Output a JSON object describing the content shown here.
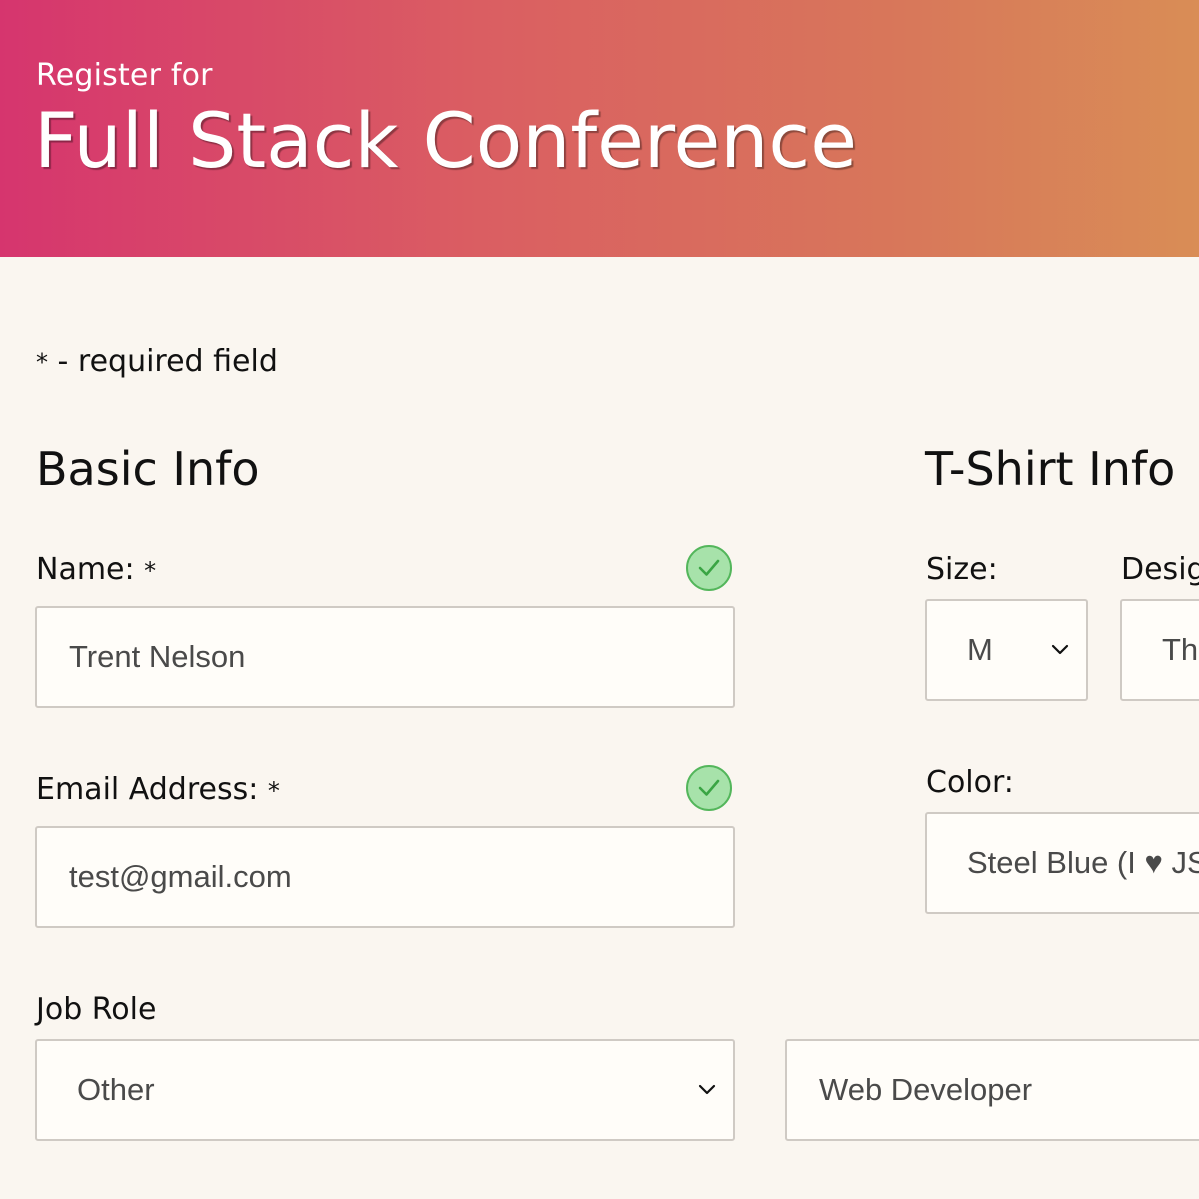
{
  "header": {
    "subtitle": "Register for",
    "title": "Full Stack Conference"
  },
  "required_note": {
    "star": "*",
    "text": " - required field"
  },
  "basic_info": {
    "heading": "Basic Info",
    "name": {
      "label": "Name: ",
      "star": "*",
      "value": "Trent Nelson",
      "valid": true
    },
    "email": {
      "label": "Email Address: ",
      "star": "*",
      "value": "test@gmail.com",
      "valid": true
    },
    "job_role": {
      "label": "Job Role",
      "selected": "Other",
      "other_value": "Web Developer"
    }
  },
  "tshirt_info": {
    "heading": "T-Shirt Info",
    "size": {
      "label": "Size:",
      "selected": "M"
    },
    "design": {
      "label": "Desig",
      "selected": "Th"
    },
    "color": {
      "label": "Color:",
      "selected": "Steel Blue (I ♥ JS"
    }
  },
  "icons": {
    "valid_check": "check-circle-icon",
    "dropdown": "chevron-down-icon"
  },
  "colors": {
    "header_gradient_start": "#d6356e",
    "header_gradient_end": "#d98d56",
    "page_background": "#faf6f0",
    "valid_fill": "#a7e2aa",
    "valid_border": "#53b65b"
  }
}
